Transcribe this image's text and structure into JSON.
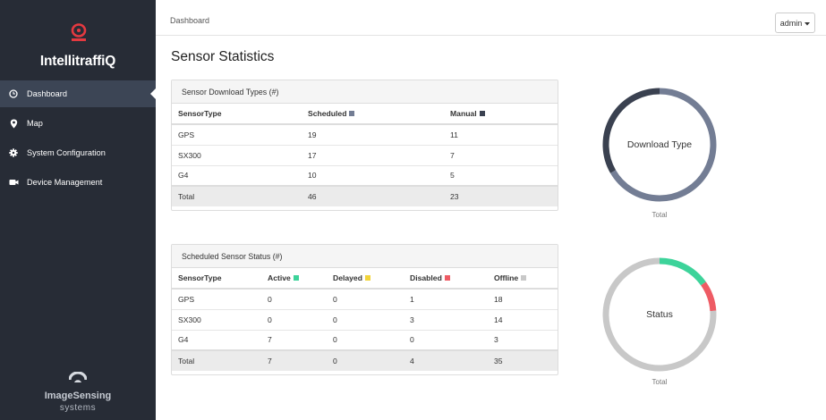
{
  "brand": {
    "name": "IntellitraffiQ"
  },
  "nav": [
    {
      "label": "Dashboard",
      "icon": "clock-icon",
      "active": true
    },
    {
      "label": "Map",
      "icon": "map-pin-icon",
      "active": false
    },
    {
      "label": "System Configuration",
      "icon": "gear-icon",
      "active": false
    },
    {
      "label": "Device Management",
      "icon": "camera-icon",
      "active": false
    }
  ],
  "company": {
    "name": "ImageSensing",
    "sub": "systems"
  },
  "topbar": {
    "breadcrumb": "Dashboard",
    "user": "admin"
  },
  "page": {
    "title": "Sensor Statistics"
  },
  "download_panel": {
    "title": "Sensor Download Types (#)",
    "headers": [
      "SensorType",
      "Scheduled",
      "Manual"
    ],
    "header_colors": [
      "",
      "#737d94",
      "#3a4150"
    ],
    "rows": [
      [
        "GPS",
        "19",
        "11"
      ],
      [
        "SX300",
        "17",
        "7"
      ],
      [
        "G4",
        "10",
        "5"
      ]
    ],
    "total": [
      "Total",
      "46",
      "23"
    ]
  },
  "status_panel": {
    "title": "Scheduled Sensor Status (#)",
    "headers": [
      "SensorType",
      "Active",
      "Delayed",
      "Disabled",
      "Offline"
    ],
    "header_colors": [
      "",
      "#3dd39a",
      "#f2d43b",
      "#ee5b64",
      "#c8c8c8"
    ],
    "rows": [
      [
        "GPS",
        "0",
        "0",
        "1",
        "18"
      ],
      [
        "SX300",
        "0",
        "0",
        "3",
        "14"
      ],
      [
        "G4",
        "7",
        "0",
        "0",
        "3"
      ]
    ],
    "total": [
      "Total",
      "7",
      "0",
      "4",
      "35"
    ]
  },
  "charts": {
    "download": {
      "center_label": "Download Type",
      "caption": "Total"
    },
    "status": {
      "center_label": "Status",
      "caption": "Total"
    }
  },
  "chart_data": [
    {
      "type": "pie",
      "title": "Download Type",
      "categories": [
        "Scheduled",
        "Manual"
      ],
      "values": [
        46,
        23
      ],
      "colors": [
        "#737d94",
        "#3a4150"
      ]
    },
    {
      "type": "pie",
      "title": "Status",
      "categories": [
        "Active",
        "Delayed",
        "Disabled",
        "Offline"
      ],
      "values": [
        7,
        0,
        4,
        35
      ],
      "colors": [
        "#3dd39a",
        "#f2d43b",
        "#ee5b64",
        "#c8c8c8"
      ]
    }
  ]
}
